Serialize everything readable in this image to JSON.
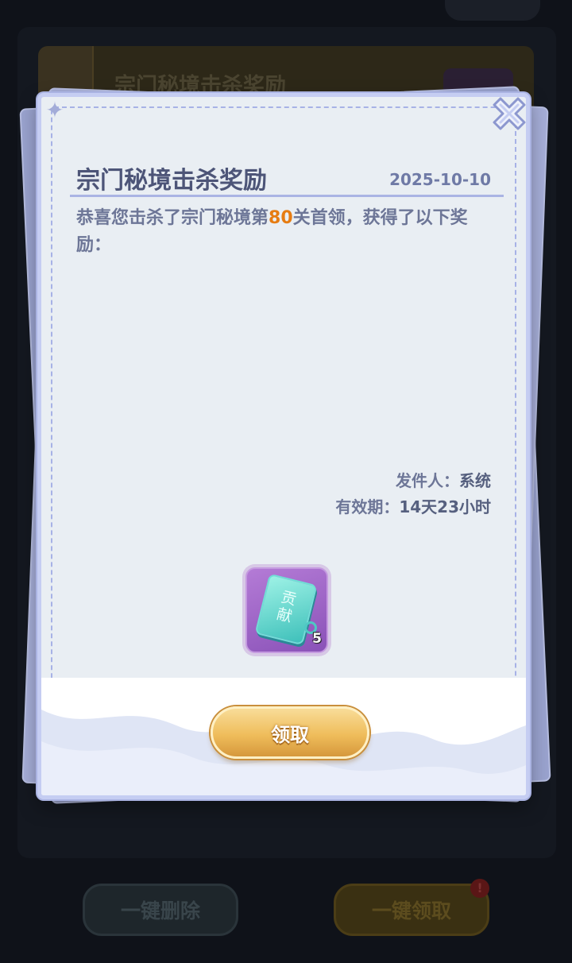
{
  "background": {
    "mail_card_title": "宗门秘境击杀奖励",
    "delete_all_label": "一键删除",
    "collect_all_label": "一键领取",
    "notification_badge": "!"
  },
  "letter": {
    "title": "宗门秘境击杀奖励",
    "date": "2025-10-10",
    "body_prefix": "恭喜您击杀了宗门秘境第",
    "body_highlight": "80",
    "body_suffix": "关首领，获得了以下奖励：",
    "sender_label": "发件人：",
    "sender_value": "系统",
    "expiry_label": "有效期：",
    "expiry_value": "14天23小时",
    "reward": {
      "icon": "contribution-token-icon",
      "icon_text": "贡献",
      "count": "5"
    },
    "claim_label": "领取"
  },
  "colors": {
    "highlight": "#e67c12",
    "title": "#4d5578",
    "paper": "#e9eef3",
    "frame": "#c5cdf2",
    "gold_button": "#efbd5b"
  }
}
